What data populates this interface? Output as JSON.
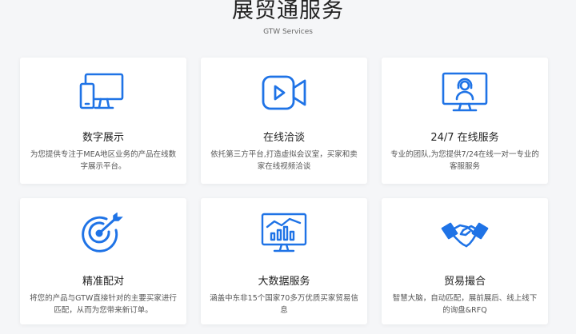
{
  "header": {
    "title": "展贸通服务",
    "subtitle": "GTW Services"
  },
  "colors": {
    "accent": "#1f73e6"
  },
  "services": [
    {
      "icon": "devices-icon",
      "title": "数字展示",
      "desc": "为您提供专注于MEA地区业务的产品在线数字展示平台。"
    },
    {
      "icon": "video-camera-icon",
      "title": "在线洽谈",
      "desc": "依托第三方平台,打造虚拟会议室，买家和卖家在线视频洽谈"
    },
    {
      "icon": "support-agent-icon",
      "title": "24/7 在线服务",
      "desc": "专业的团队,为您提供7/24在线一对一专业的客服服务"
    },
    {
      "icon": "target-icon",
      "title": "精准配对",
      "desc": "将您的产品与GTW直接针对的主要买家进行匹配，从而为您带来新订单。"
    },
    {
      "icon": "analytics-monitor-icon",
      "title": "大数据服务",
      "desc": "涵盖中东非15个国家70多万优质买家贸易信息"
    },
    {
      "icon": "handshake-icon",
      "title": "贸易撮合",
      "desc": "智慧大脑，自动匹配，展前展后、线上线下的询盘&RFQ"
    }
  ]
}
